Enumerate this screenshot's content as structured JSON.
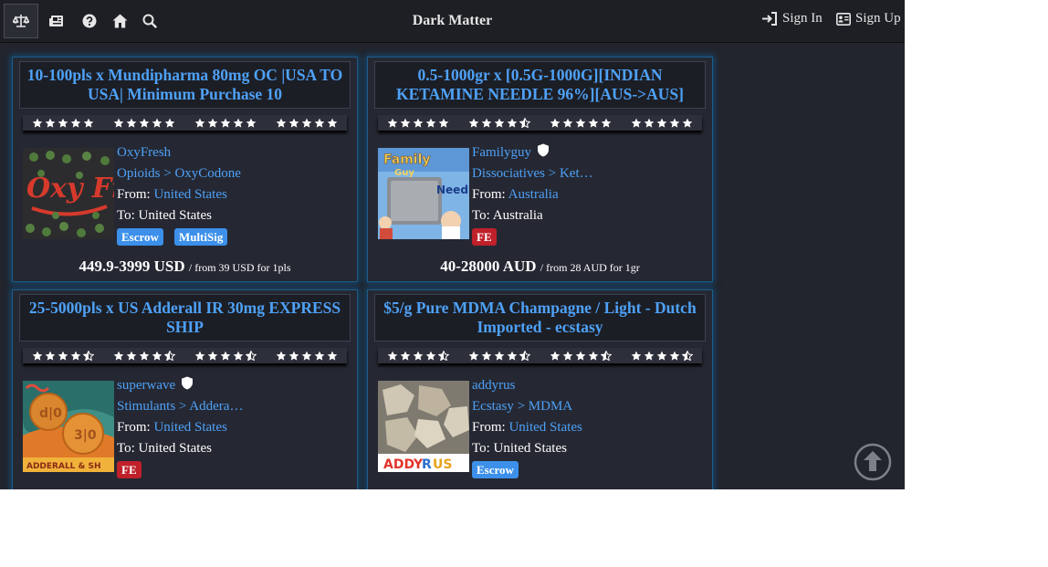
{
  "header": {
    "brand": "Dark Matter",
    "sign_in": "Sign In",
    "sign_up": "Sign Up"
  },
  "colors": {
    "link": "#4ea1f7",
    "escrow_badge": "#3c90ea",
    "fe_badge": "#c0202a",
    "card_glow": "#1d5d8b"
  },
  "listings": [
    {
      "title": "10-100pls x Mundipharma 80mg OC |USA TO USA| Minimum Purchase 10",
      "ratings": [
        5,
        5,
        5,
        5
      ],
      "vendor": "OxyFresh",
      "category": "Opioids > OxyCodone",
      "from_label": "From:",
      "from": "United States",
      "to_label": "To:",
      "to": "United States",
      "badges": [
        "Escrow",
        "MultiSig"
      ],
      "price": "449.9-3999 USD",
      "price_note": "/ from 39 USD for 1pls"
    },
    {
      "title": "0.5-1000gr x [0.5G-1000G][INDIAN KETAMINE NEEDLE 96%][AUS->AUS]",
      "ratings": [
        5,
        4.5,
        5,
        5
      ],
      "vendor": "Familyguy",
      "category": "Dissociatives > Ket…",
      "from_label": "From:",
      "from": "Australia",
      "to_label": "To:",
      "to": "Australia",
      "badges": [
        "FE"
      ],
      "price": "40-28000 AUD",
      "price_note": "/ from 28 AUD for 1gr"
    },
    {
      "title": "25-5000pls x US Adderall IR 30mg EXPRESS SHIP",
      "ratings": [
        4.5,
        4.5,
        4.5,
        5
      ],
      "vendor": "superwave",
      "category": "Stimulants > Addera…",
      "from_label": "From:",
      "from": "United States",
      "to_label": "To:",
      "to": "United States",
      "badges": [
        "FE"
      ]
    },
    {
      "title": "$5/g Pure MDMA Champagne / Light - Dutch Imported - ecstasy",
      "ratings": [
        4.5,
        4.5,
        4.5,
        4.5
      ],
      "vendor": "addyrus",
      "category": "Ecstasy > MDMA",
      "from_label": "From:",
      "from": "United States",
      "to_label": "To:",
      "to": "United States",
      "badges": [
        "Escrow"
      ]
    }
  ],
  "icons": [
    "scale-icon",
    "newspaper-icon",
    "help-icon",
    "home-icon",
    "search-icon",
    "sign-in-icon",
    "id-card-icon",
    "verified-shield-icon",
    "star-icon",
    "scroll-to-top-icon"
  ]
}
